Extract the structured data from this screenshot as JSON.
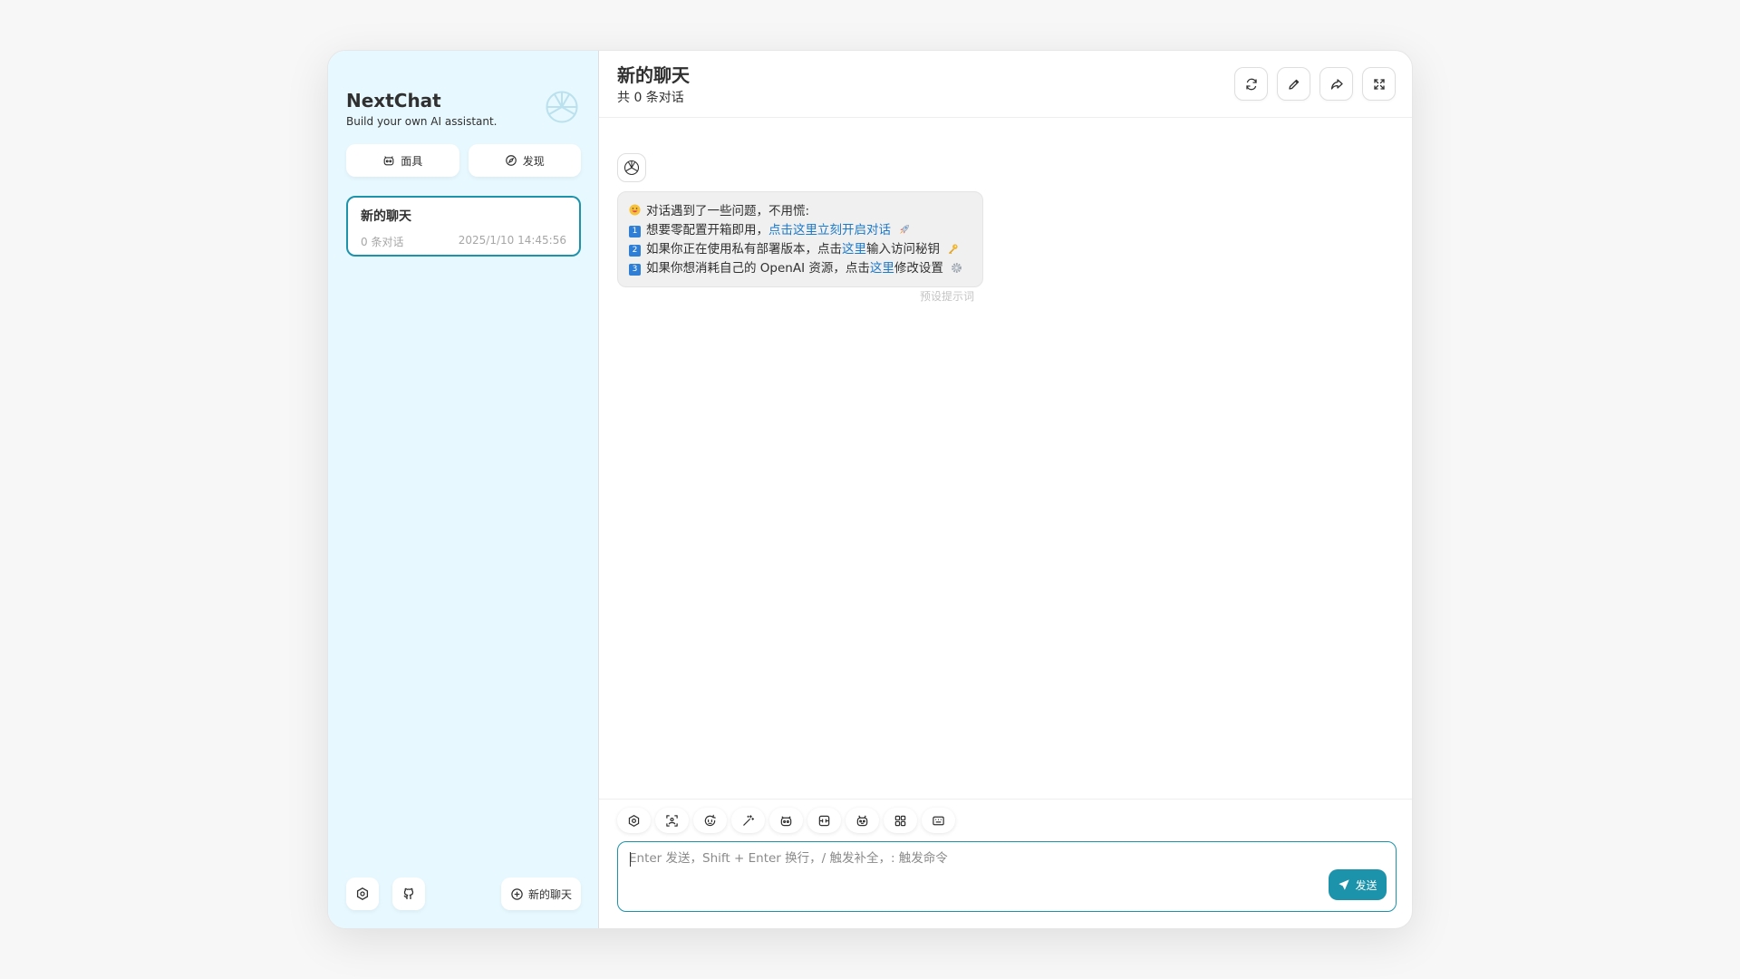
{
  "colors": {
    "primary": "#1d93ab",
    "sidebar_bg": "#e7f8ff",
    "link": "#1d79c9",
    "badge": "#2f7fd6"
  },
  "sidebar": {
    "title": "NextChat",
    "subtitle": "Build your own AI assistant.",
    "logo_icon": "openai-logo",
    "buttons": [
      {
        "label": "面具",
        "icon": "mask-icon"
      },
      {
        "label": "发现",
        "icon": "compass-icon"
      }
    ],
    "chats": [
      {
        "title": "新的聊天",
        "count": "0 条对话",
        "time": "2025/1/10 14:45:56"
      }
    ],
    "footer": {
      "settings_icon": "settings-icon",
      "github_icon": "github-icon",
      "new_chat_label": "新的聊天"
    }
  },
  "header": {
    "title": "新的聊天",
    "subtitle": "共 0 条对话",
    "actions": [
      "reload-icon",
      "edit-icon",
      "share-icon",
      "fullscreen-icon"
    ]
  },
  "message": {
    "intro": "对话遇到了一些问题，不用慌:",
    "lines": [
      {
        "num": "1",
        "pre": "想要零配置开箱即用，",
        "link": "点击这里立刻开启对话",
        "post": ""
      },
      {
        "num": "2",
        "pre": "如果你正在使用私有部署版本，点击",
        "link": "这里",
        "post": "输入访问秘钥"
      },
      {
        "num": "3",
        "pre": "如果你想消耗自己的 OpenAI 资源，点击",
        "link": "这里",
        "post": "修改设置"
      }
    ],
    "date": "预设提示词"
  },
  "toolbar": {
    "tools": [
      "settings-icon",
      "image-icon",
      "robot-clear-icon",
      "magic-wand-icon",
      "mask-icon",
      "break-icon",
      "robot-icon",
      "plugin-grid-icon",
      "shortcut-key-icon"
    ]
  },
  "input": {
    "placeholder": "Enter 发送，Shift + Enter 换行，/ 触发补全，: 触发命令",
    "send_label": "发送"
  }
}
